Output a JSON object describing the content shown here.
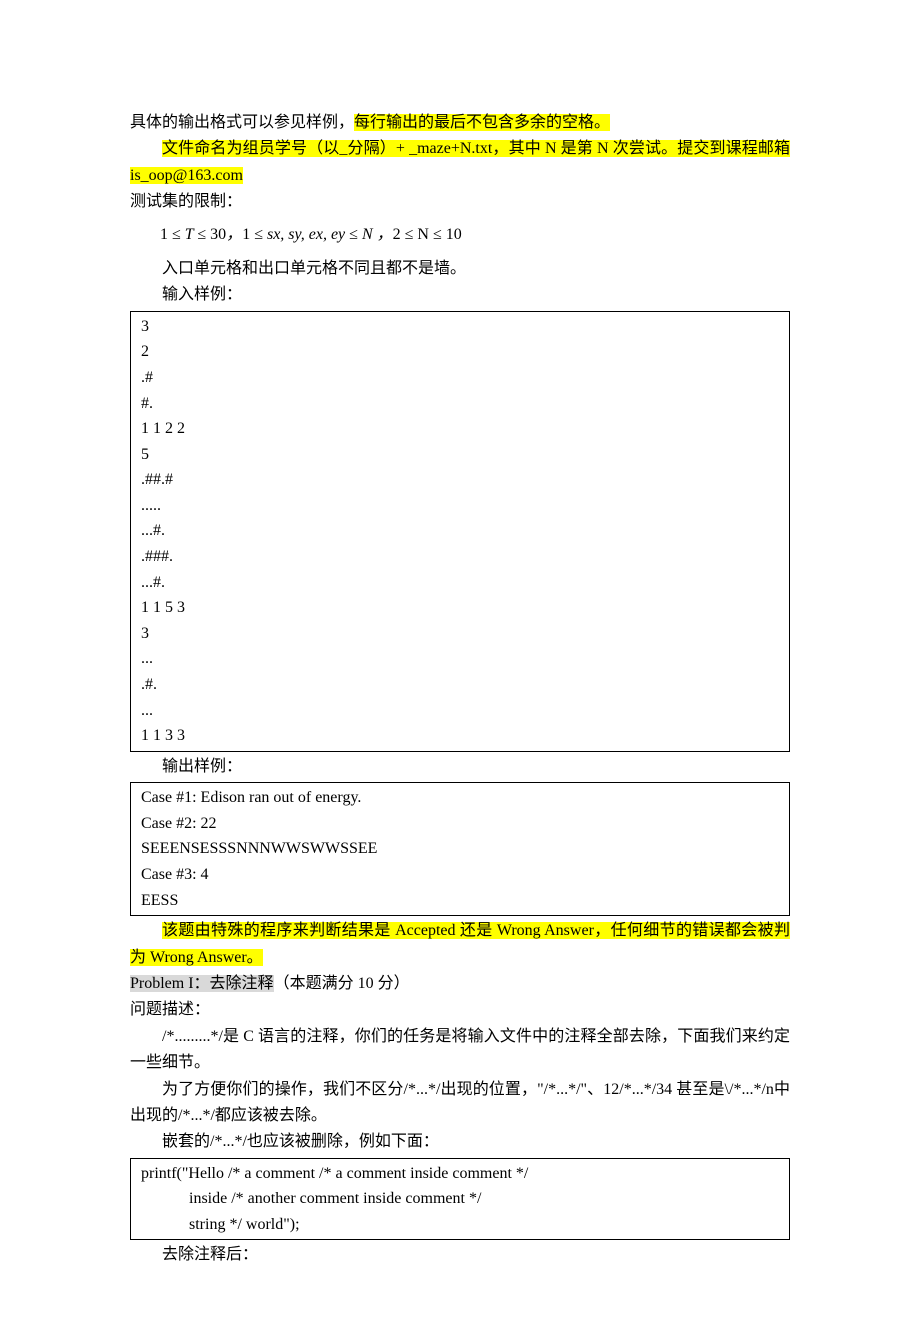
{
  "p1": {
    "a": "具体的输出格式可以参见样例，",
    "b": "每行输出的最后不包含多余的空格。"
  },
  "p2": {
    "a": "文件命名为组员学号（以_分隔）+ _maze+N.txt，其中 N 是第 N 次尝试。提交到课程邮箱 is_oop@163.com"
  },
  "p3": "测试集的限制：",
  "math": {
    "t_low": "1",
    "t_high": "30",
    "sx": "sx, sy, ex, ey",
    "n_sym": "N",
    "n_low": "2",
    "n_high": "10"
  },
  "p4": "入口单元格和出口单元格不同且都不是墙。",
  "p5": "输入样例：",
  "input_sample": "3\n2\n.#\n#.\n1 1 2 2\n5\n.##.#\n.....\n...#.\n.###.\n...#.\n1 1 5 3\n3\n...\n.#.\n...\n1 1 3 3",
  "p6": "输出样例：",
  "output_sample": "Case #1: Edison ran out of energy.\nCase #2: 22\nSEEENSESSSNNNWWSWWSSEE\nCase #3: 4\nEESS",
  "p7": {
    "a": "该题由特殊的程序来判断结果是 Accepted 还是 Wrong Answer，任何细节的错误都会被判为 Wrong Answer。"
  },
  "p8": {
    "a": "Problem I：去除注释",
    "b": "（本题满分 10 分）"
  },
  "p9": "问题描述：",
  "p10": "/*.........*/是 C 语言的注释，你们的任务是将输入文件中的注释全部去除，下面我们来约定一些细节。",
  "p11": "为了方便你们的操作，我们不区分/*...*/出现的位置，\"/*...*/\"、12/*...*/34 甚至是\\/*...*/n中出现的/*...*/都应该被去除。",
  "p12": "嵌套的/*...*/也应该被删除，例如下面：",
  "nested_sample": "printf(\"Hello /* a comment /* a comment inside comment */\n            inside /* another comment inside comment */\n            string */ world\");",
  "p13": "去除注释后："
}
